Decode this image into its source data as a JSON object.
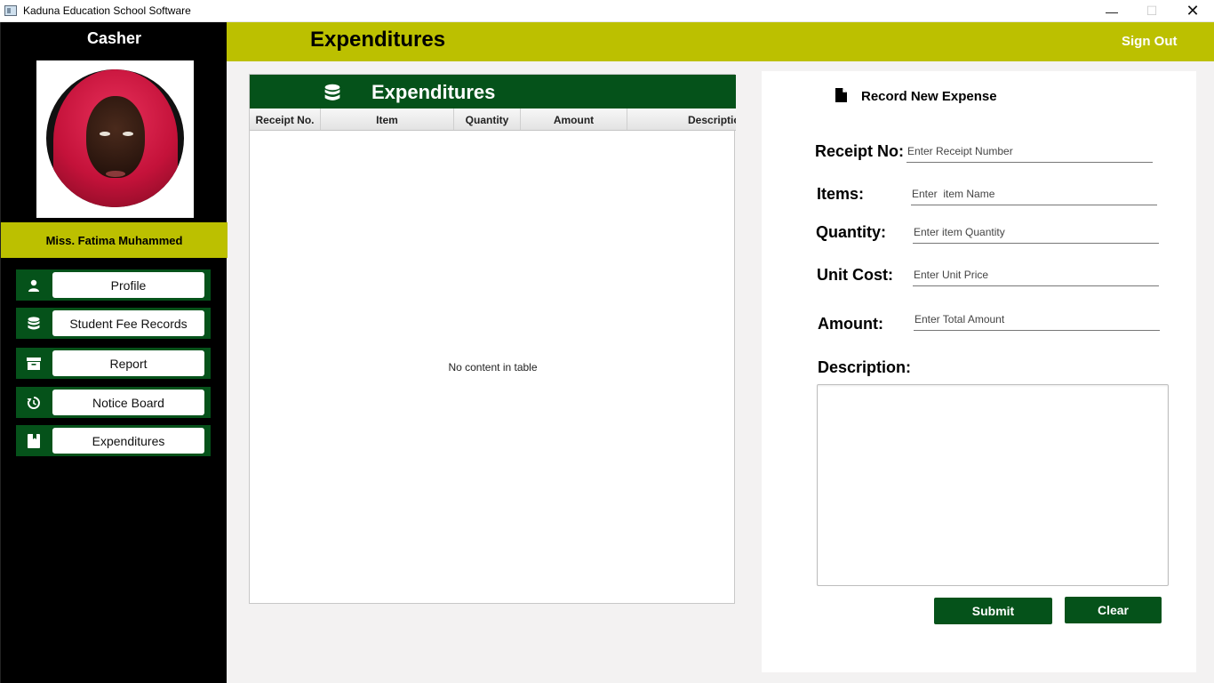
{
  "window": {
    "title": "Kaduna Education School Software",
    "minimize_glyph": "—",
    "maximize_glyph": "☐",
    "close_glyph": "✕"
  },
  "sidebar": {
    "role": "Casher",
    "user_name": "Miss. Fatima Muhammed",
    "items": [
      {
        "label": "Profile",
        "icon": "person-icon"
      },
      {
        "label": "Student Fee Records",
        "icon": "database-icon"
      },
      {
        "label": "Report",
        "icon": "archive-icon"
      },
      {
        "label": "Notice Board",
        "icon": "history-icon"
      },
      {
        "label": "Expenditures",
        "icon": "bookmark-book-icon"
      }
    ]
  },
  "header": {
    "title": "Expenditures",
    "sign_out": "Sign Out"
  },
  "table": {
    "title": "Expenditures",
    "icon": "database-icon",
    "columns": [
      "Receipt No.",
      "Item",
      "Quantity",
      "Amount",
      "Description"
    ],
    "empty_message": "No content in table"
  },
  "form": {
    "title": "Record New Expense",
    "title_icon": "file-icon",
    "fields": {
      "receipt_no": {
        "label": "Receipt No:",
        "placeholder": "Enter Receipt Number",
        "value": ""
      },
      "items": {
        "label": "Items:",
        "placeholder": "Enter  item Name",
        "value": ""
      },
      "quantity": {
        "label": "Quantity:",
        "placeholder": "Enter item Quantity",
        "value": ""
      },
      "unit_cost": {
        "label": "Unit Cost:",
        "placeholder": "Enter Unit Price",
        "value": ""
      },
      "amount": {
        "label": "Amount:",
        "placeholder": "Enter Total Amount",
        "value": ""
      },
      "description": {
        "label": "Description:",
        "value": ""
      }
    },
    "submit_label": "Submit",
    "clear_label": "Clear"
  },
  "colors": {
    "accent_olive": "#bcc000",
    "accent_green": "#05521a",
    "sidebar_bg": "#000000",
    "content_bg": "#f3f2f2"
  }
}
